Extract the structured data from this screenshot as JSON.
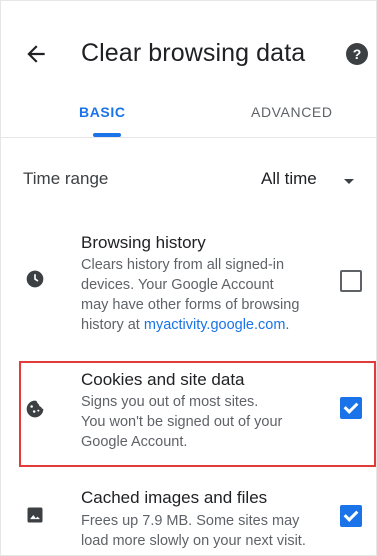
{
  "header": {
    "title": "Clear browsing data",
    "help_glyph": "?"
  },
  "tabs": [
    {
      "label": "BASIC",
      "active": true
    },
    {
      "label": "ADVANCED",
      "active": false
    }
  ],
  "time_range": {
    "label": "Time range",
    "value": "All time"
  },
  "items": [
    {
      "title": "Browsing history",
      "desc_lines": [
        "Clears history from all signed-in",
        "devices. Your Google Account",
        "may have other forms of browsing",
        "history at "
      ],
      "link_text": "myactivity.google.com",
      "after_link": ".",
      "checked": false,
      "icon": "clock-icon"
    },
    {
      "title": "Cookies and site data",
      "desc_lines": [
        "Signs you out of most sites.",
        "You won't be signed out of your",
        "Google Account."
      ],
      "checked": true,
      "icon": "cookie-icon"
    },
    {
      "title": "Cached images and files",
      "desc_lines": [
        "Frees up 7.9 MB. Some sites may",
        "load more slowly on your next visit."
      ],
      "checked": true,
      "icon": "image-icon"
    }
  ],
  "colors": {
    "accent": "#1a73e8",
    "highlight": "#e33a3a"
  }
}
